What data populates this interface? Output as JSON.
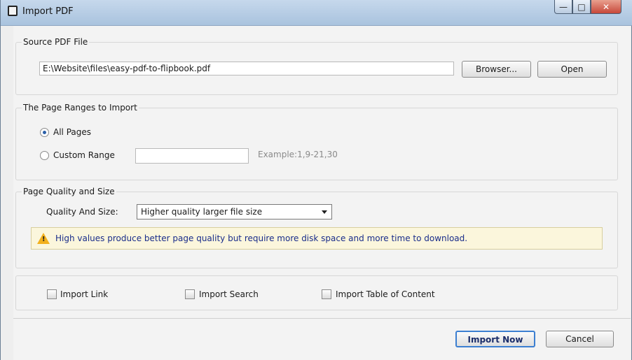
{
  "window": {
    "title": "Import PDF",
    "controls": {
      "minimize": "—",
      "maximize": "□",
      "close": "✕"
    }
  },
  "source": {
    "legend": "Source PDF File",
    "path_value": "E:\\Website\\files\\easy-pdf-to-flipbook.pdf",
    "browse_label": "Browser...",
    "open_label": "Open"
  },
  "ranges": {
    "legend": "The Page Ranges to Import",
    "all_pages_label": "All Pages",
    "custom_label": "Custom Range",
    "custom_value": "",
    "example_hint": "Example:1,9-21,30",
    "selected": "All Pages"
  },
  "quality": {
    "legend": "Page Quality and Size",
    "field_label": "Quality And Size:",
    "selected_option": "Higher quality larger file size",
    "warning_text": "High values produce better page quality but require more disk space and more time to download."
  },
  "options": {
    "import_link": {
      "label": "Import Link",
      "checked": false
    },
    "import_search": {
      "label": "Import Search",
      "checked": false
    },
    "import_toc": {
      "label": "Import Table of Content",
      "checked": false
    }
  },
  "footer": {
    "import_now_label": "Import Now",
    "cancel_label": "Cancel"
  },
  "colors": {
    "titlebar": "#b8cde4",
    "close_button": "#c7483a",
    "warning_bg": "#fbf6dc",
    "warning_text": "#1a2d8a",
    "radio_selected": "#2b5fa8"
  }
}
